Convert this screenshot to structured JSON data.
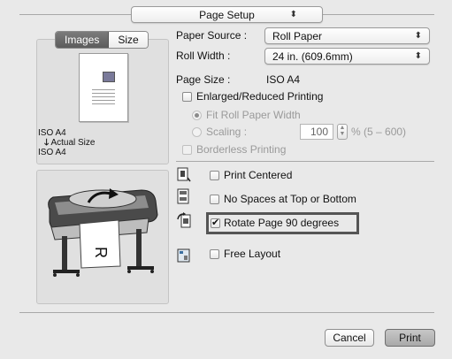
{
  "header": {
    "preset_label": "Page Setup"
  },
  "left_panel": {
    "tabs": [
      "Images",
      "Size"
    ],
    "active_tab": "Images",
    "size_info": {
      "original": "ISO A4",
      "mode": "Actual Size",
      "output": "ISO A4"
    }
  },
  "settings": {
    "paper_source": {
      "label": "Paper Source :",
      "value": "Roll Paper"
    },
    "roll_width": {
      "label": "Roll Width :",
      "value": "24 in. (609.6mm)"
    },
    "page_size": {
      "label": "Page Size :",
      "value": "ISO A4"
    },
    "enlarged_reduced": {
      "label": "Enlarged/Reduced Printing",
      "checked": false
    },
    "fit_roll": {
      "label": "Fit Roll Paper Width",
      "selected": true,
      "enabled": false
    },
    "scaling": {
      "label": "Scaling :",
      "value": "100",
      "range": "% (5 – 600)",
      "enabled": false
    },
    "borderless": {
      "label": "Borderless Printing",
      "checked": false,
      "enabled": false
    }
  },
  "options": {
    "print_centered": {
      "label": "Print Centered",
      "checked": false
    },
    "no_spaces": {
      "label": "No Spaces at Top or Bottom",
      "checked": false
    },
    "rotate": {
      "label": "Rotate Page 90 degrees",
      "checked": true
    },
    "free_layout": {
      "label": "Free Layout",
      "checked": false
    }
  },
  "printer_preview": {
    "paper_letter": "R"
  },
  "footer": {
    "cancel_label": "Cancel",
    "print_label": "Print"
  },
  "icons": [
    "chevron-updown-icon",
    "arrow-down-icon",
    "print-centered-icon",
    "no-spaces-icon",
    "rotate-page-icon",
    "free-layout-icon",
    "printer-illustration"
  ]
}
